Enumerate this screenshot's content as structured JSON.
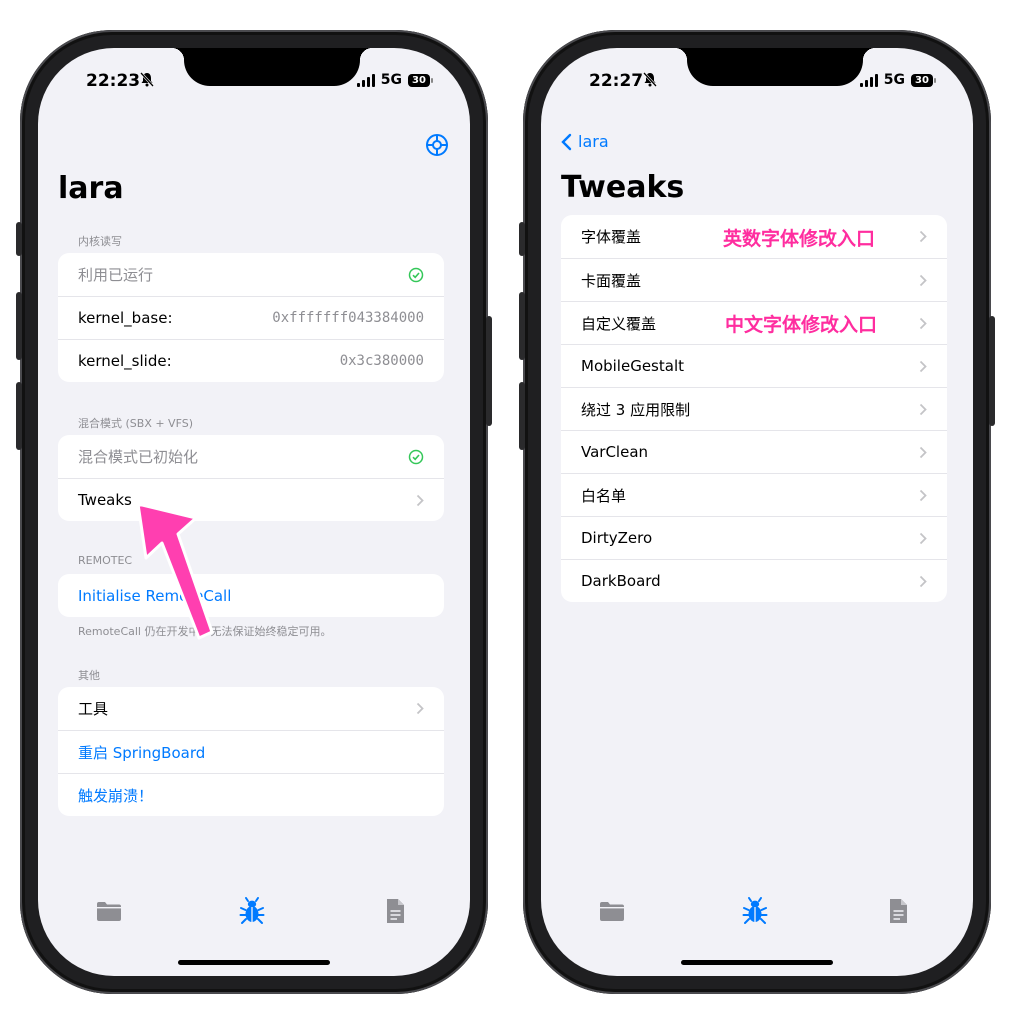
{
  "left": {
    "status": {
      "time": "22:23",
      "network": "5G",
      "battery": "30"
    },
    "title": "lara",
    "section_kernel": {
      "header": "内核读写",
      "rows": [
        {
          "label": "利用已运行",
          "value": ""
        },
        {
          "label": "kernel_base:",
          "value": "0xfffffff043384000"
        },
        {
          "label": "kernel_slide:",
          "value": "0x3c380000"
        }
      ]
    },
    "section_hybrid": {
      "header": "混合模式 (SBX + VFS)",
      "rows": [
        {
          "label": "混合模式已初始化"
        },
        {
          "label": "Tweaks"
        }
      ]
    },
    "section_remote": {
      "header": "REMOTEC",
      "action": "Initialise RemoteCall",
      "footer": "RemoteCall 仍在开发中，无法保证始终稳定可用。"
    },
    "section_other": {
      "header": "其他",
      "rows": [
        {
          "label": "工具"
        },
        {
          "label": "重启 SpringBoard"
        },
        {
          "label": "触发崩溃！"
        }
      ]
    },
    "tabs": [
      {
        "icon": "folder-icon"
      },
      {
        "icon": "bug-icon"
      },
      {
        "icon": "document-icon"
      }
    ]
  },
  "right": {
    "status": {
      "time": "22:27",
      "network": "5G",
      "battery": "30"
    },
    "back_label": "lara",
    "title": "Tweaks",
    "rows": [
      {
        "label": "字体覆盖",
        "annotation": "英数字体修改入口"
      },
      {
        "label": "卡面覆盖"
      },
      {
        "label": "自定义覆盖",
        "annotation": "中文字体修改入口"
      },
      {
        "label": "MobileGestalt"
      },
      {
        "label": "绕过 3 应用限制"
      },
      {
        "label": "VarClean"
      },
      {
        "label": "白名单"
      },
      {
        "label": "DirtyZero"
      },
      {
        "label": "DarkBoard"
      }
    ]
  },
  "colors": {
    "accent": "#007aff",
    "success": "#34c759",
    "annotation": "#ff2d9f",
    "background": "#f2f2f7"
  }
}
